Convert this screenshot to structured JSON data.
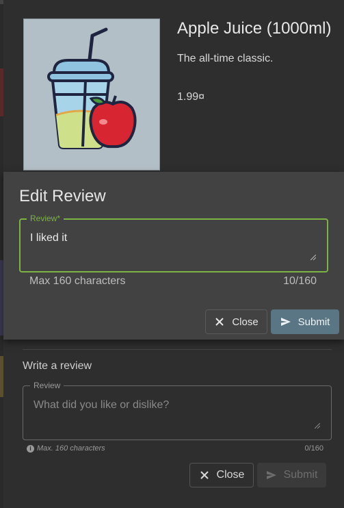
{
  "product": {
    "title": "Apple Juice (1000ml)",
    "description": "The all-time classic.",
    "price": "1.99¤",
    "image_icon": "juice-apple-illustration"
  },
  "edit_review": {
    "title": "Edit Review",
    "field_label": "Review*",
    "field_value": "I liked it",
    "hint": "Max 160 characters",
    "counter": "10/160",
    "close_label": "Close",
    "submit_label": "Submit"
  },
  "write_review": {
    "title": "Write a review",
    "field_label": "Review",
    "placeholder": "What did you like or dislike?",
    "hint": "Max. 160 characters",
    "counter": "0/160",
    "close_label": "Close",
    "submit_label": "Submit"
  },
  "colors": {
    "accent_green": "#7cb342",
    "submit_blue": "#5a7584",
    "modal_bg": "#424242",
    "dialog_bg": "#2e2e2e"
  }
}
